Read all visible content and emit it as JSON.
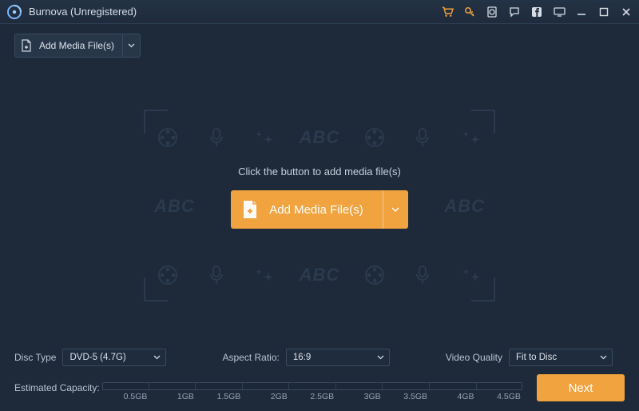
{
  "titlebar": {
    "title": "Burnova (Unregistered)"
  },
  "toolbar": {
    "add_label": "Add Media File(s)"
  },
  "main": {
    "hint": "Click the button to add media file(s)",
    "button_label": "Add Media File(s)",
    "watermark_text": "ABC"
  },
  "controls": {
    "disc_type_label": "Disc Type",
    "disc_type_value": "DVD-5 (4.7G)",
    "aspect_ratio_label": "Aspect Ratio:",
    "aspect_ratio_value": "16:9",
    "video_quality_label": "Video Quality",
    "video_quality_value": "Fit to Disc",
    "capacity_label": "Estimated Capacity:",
    "capacity_ticks": [
      "0.5GB",
      "1GB",
      "1.5GB",
      "2GB",
      "2.5GB",
      "3GB",
      "3.5GB",
      "4GB",
      "4.5GB"
    ],
    "next_label": "Next"
  }
}
